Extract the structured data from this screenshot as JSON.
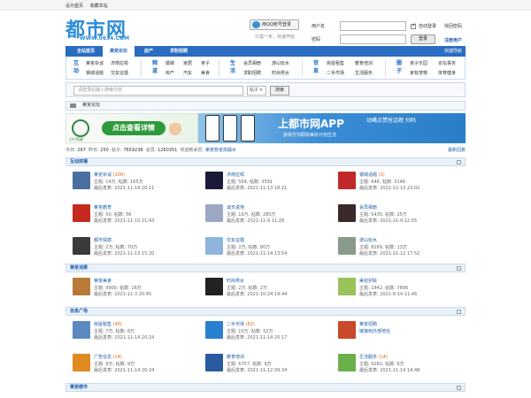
{
  "topbar": {
    "set_home": "设为首页",
    "bookmark": "收藏本站"
  },
  "logo": {
    "main": "都市网",
    "sub": "WWW.0634.COM"
  },
  "qq_login": {
    "label": "用QQ帐号登录",
    "tip": "只需一步，快速开始"
  },
  "login": {
    "username_label": "用户名",
    "password_label": "密码",
    "username_value": "",
    "password_value": "",
    "remember_label": "自动登录",
    "login_button": "登录",
    "find_password": "找回密码",
    "register": "注册用户"
  },
  "nav": {
    "items": [
      "全站首页",
      "莱芜论坛",
      "房产",
      "求职招聘"
    ],
    "active_index": 1,
    "quick": "快捷导航"
  },
  "categories": [
    {
      "head": "互动",
      "links": [
        "莱芜杂谈",
        "济南拉呱",
        "钢城话题",
        "交友征婚"
      ]
    },
    {
      "head": "频道",
      "links": [
        "婚嫁",
        "家居",
        "亲子",
        "房产",
        "汽车",
        "美食"
      ]
    },
    {
      "head": "生活",
      "links": [
        "会员相册",
        "游山玩水",
        "求职招聘",
        "时尚男女"
      ]
    },
    {
      "head": "信息",
      "links": [
        "房屋租售",
        "教育培训",
        "二手市场",
        "生活服务"
      ]
    },
    {
      "head": "圈子",
      "links": [
        "亲子乐园",
        "论坛事务",
        "家有宠物",
        "体育健身"
      ]
    }
  ],
  "search": {
    "placeholder": "请登录后输入搜索内容",
    "type": "帖子",
    "button": "搜索"
  },
  "breadcrumb": "莱芜论坛",
  "banner": {
    "left_logo": "日兴驾驶",
    "left_pill": "点击查看详情",
    "app_title": "上都市网APP",
    "app_sub": "获奖打扫即获美好计划生活",
    "right_text": "动嘴点赞抢话题 扫码"
  },
  "stats": {
    "today_label": "今日:",
    "today": "267",
    "yesterday_label": "昨日:",
    "yesterday": "250",
    "posts_label": "帖子:",
    "posts": "7659238",
    "members_label": "会员:",
    "members": "1260351",
    "welcome_label": "欢迎新会员:",
    "newest": "莱芜管道测漏水",
    "latest": "最新回复"
  },
  "sections": [
    {
      "title": "互动拼播",
      "forums": [
        {
          "name": "莱芜杂谈",
          "today": "(100)",
          "topics": "主题: 14万",
          "posts": "帖数: 165万",
          "last": "最后发表: 2021-11-14 20:11",
          "color": "#4a6fa0"
        },
        {
          "name": "济南拉呱",
          "today": "",
          "topics": "主题: 569",
          "posts": "帖数: 3591",
          "last": "最后发表: 2021-11-13 18:21",
          "color": "#1a1a3a"
        },
        {
          "name": "钢城话题",
          "today": "(1)",
          "topics": "主题: 646",
          "posts": "帖数: 3146",
          "last": "最后发表: 2021-11-13 23:02",
          "color": "#c0282a"
        },
        {
          "name": "莱芜教育",
          "today": "",
          "topics": "主题: 50",
          "posts": "帖数: 56",
          "last": "最后发表: 2021-11-10 21:43",
          "color": "#c52a1f"
        },
        {
          "name": "谈天说地",
          "today": "",
          "topics": "主题: 16万",
          "posts": "帖数: 280万",
          "last": "最后发表: 2021-11-9 11:28",
          "color": "#9aa8c4"
        },
        {
          "name": "会员相册",
          "today": "",
          "topics": "主题: 5435",
          "posts": "帖数: 25万",
          "last": "最后发表: 2021-11-9 12:05",
          "color": "#3a2a2a"
        },
        {
          "name": "都市情感",
          "today": "",
          "topics": "主题: 2万",
          "posts": "帖数: 70万",
          "last": "最后发表: 2021-11-13 15:20",
          "color": "#3a3a3a"
        },
        {
          "name": "交友征婚",
          "today": "",
          "topics": "主题: 2万",
          "posts": "帖数: 80万",
          "last": "最后发表: 2021-11-14 13:54",
          "color": "#8fb4de"
        },
        {
          "name": "游山玩水",
          "today": "",
          "topics": "主题: 8269",
          "posts": "帖数: 13万",
          "last": "最后发表: 2021-11-12 17:52",
          "color": "#8a9a8a"
        }
      ]
    },
    {
      "title": "莱芜消费",
      "forums": [
        {
          "name": "莱芜美食",
          "today": "",
          "topics": "主题: 9900",
          "posts": "帖数: 16万",
          "last": "最后发表: 2021-11-3 20:45",
          "color": "#b87a3a"
        },
        {
          "name": "时尚男女",
          "today": "",
          "topics": "主题: 2万",
          "posts": "帖数: 2万",
          "last": "最后发表: 2021-10-24 19:44",
          "color": "#222222"
        },
        {
          "name": "美容护肤",
          "today": "",
          "topics": "主题: 1842",
          "posts": "帖数: 7806",
          "last": "最后发表: 2021-9-14 11:46",
          "color": "#9ac25a"
        }
      ]
    },
    {
      "title": "信息广场",
      "forums": [
        {
          "name": "房屋租售",
          "today": "(40)",
          "topics": "主题: 7万",
          "posts": "帖数: 8万",
          "last": "最后发表: 2021-11-14 20:24",
          "color": "#5a8ac0"
        },
        {
          "name": "二手市场",
          "today": "(62)",
          "topics": "主题: 10万",
          "posts": "帖数: 52万",
          "last": "最后发表: 2021-11-14 20:17",
          "color": "#2a80d0"
        },
        {
          "name": "莱芜招聘",
          "today": "",
          "link": "链接到外部地址",
          "color": "#c84a2a"
        },
        {
          "name": "广告信息",
          "today": "(14)",
          "topics": "主题: 9万",
          "posts": "帖数: 9万",
          "last": "最后发表: 2021-11-14 20:24",
          "color": "#e08a20"
        },
        {
          "name": "教育培训",
          "today": "",
          "topics": "主题: 6757",
          "posts": "帖数: 9万",
          "last": "最后发表: 2021-11-12 09:34",
          "color": "#2a5aa0"
        },
        {
          "name": "生活服务",
          "today": "(14)",
          "topics": "主题: 9262",
          "posts": "帖数: 6万",
          "last": "最后发表: 2021-11-14 14:48",
          "color": "#6ab04a"
        }
      ]
    },
    {
      "title": "莱芜楼市",
      "forums": []
    }
  ]
}
